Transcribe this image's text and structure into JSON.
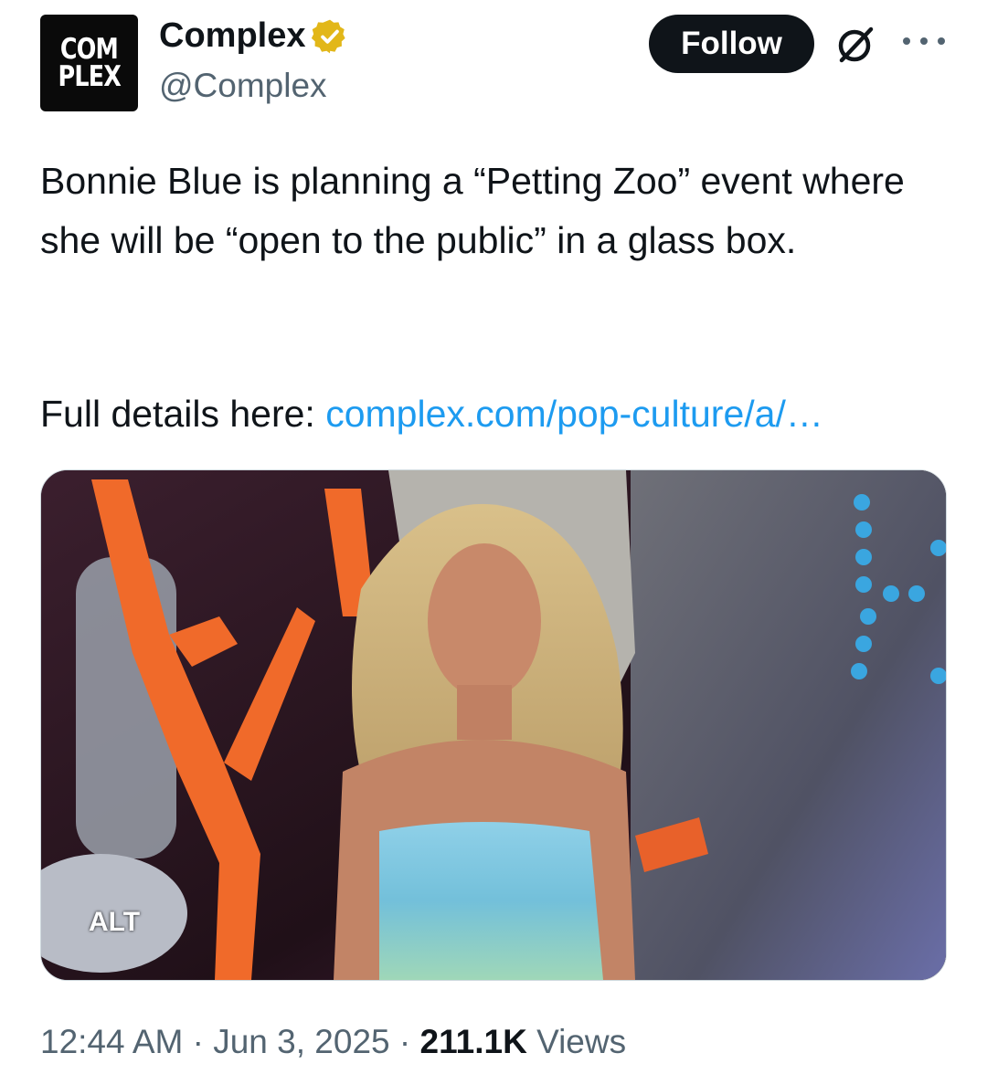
{
  "author": {
    "avatar_line1": "COM",
    "avatar_line2": "PLEX",
    "name": "Complex",
    "handle": "@Complex",
    "verified_color": "#e2b719"
  },
  "actions": {
    "follow_label": "Follow",
    "grok_icon": "grok-icon",
    "more_icon": "more-icon"
  },
  "tweet": {
    "text": "Bonnie Blue is planning a “Petting Zoo” event where she will be “open to the public” in a glass box.",
    "details_label": "Full details here: ",
    "link": "complex.com/pop-culture/a/…"
  },
  "media": {
    "alt_label": "ALT"
  },
  "meta": {
    "time": "12:44 AM",
    "sep1": " · ",
    "date": "Jun 3, 2025",
    "sep2": " · ",
    "views_count": "211.1K",
    "views_label": " Views"
  },
  "colors": {
    "link": "#1d9bf0",
    "follow_bg": "#0f1419",
    "muted": "#536471"
  }
}
